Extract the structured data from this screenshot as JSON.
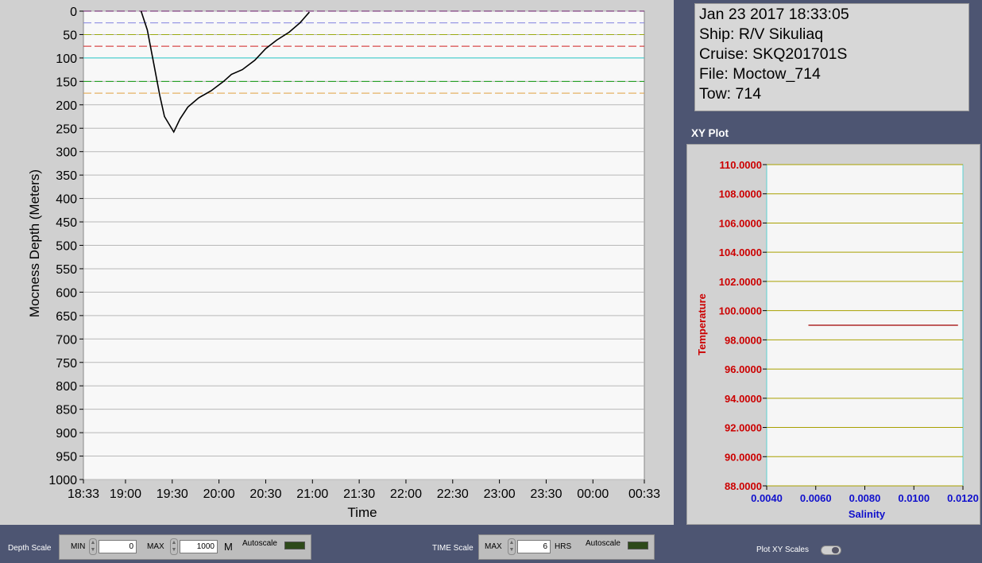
{
  "info": {
    "datetime": "Jan 23 2017 18:33:05",
    "ship": "Ship: R/V Sikuliaq",
    "cruise": "Cruise: SKQ201701S",
    "file": "File: Moctow_714",
    "tow": "Tow: 714"
  },
  "xy_plot": {
    "title": "XY Plot"
  },
  "bottom": {
    "depth_scale_label": "Depth Scale",
    "min_label": "MIN",
    "min_value": "0",
    "max_label": "MAX",
    "max_value": "1000",
    "depth_unit": "M",
    "autoscale_label": "Autoscale",
    "time_scale_label": "TIME Scale",
    "time_max_label": "MAX",
    "time_max_value": "6",
    "time_unit": "HRS",
    "time_autoscale_label": "Autoscale",
    "plot_xy_scales_label": "Plot XY Scales"
  },
  "chart_data": [
    {
      "type": "line",
      "xlabel": "Time",
      "ylabel": "Mocness Depth (Meters)",
      "x_ticks": [
        "18:33",
        "19:00",
        "19:30",
        "20:00",
        "20:30",
        "21:00",
        "21:30",
        "22:00",
        "22:30",
        "23:00",
        "23:30",
        "00:00",
        "00:33"
      ],
      "y_ticks": [
        "0",
        "50",
        "100",
        "150",
        "200",
        "250",
        "300",
        "350",
        "400",
        "450",
        "500",
        "550",
        "600",
        "650",
        "700",
        "750",
        "800",
        "850",
        "900",
        "950",
        "1000"
      ],
      "ylim": [
        0,
        1000
      ],
      "y_reversed": true,
      "grid": true,
      "reference_lines": [
        {
          "depth": 0,
          "color": "#6a1a6a"
        },
        {
          "depth": 25,
          "color": "#8080e0"
        },
        {
          "depth": 50,
          "color": "#9aaa10"
        },
        {
          "depth": 75,
          "color": "#d02020"
        },
        {
          "depth": 100,
          "color": "#30d0d0"
        },
        {
          "depth": 150,
          "color": "#109a10"
        },
        {
          "depth": 175,
          "color": "#e0a040"
        }
      ],
      "series": [
        {
          "color": "#000000",
          "points": [
            [
              "19:10",
              0
            ],
            [
              "19:14",
              40
            ],
            [
              "19:18",
              110
            ],
            [
              "19:22",
              180
            ],
            [
              "19:25",
              225
            ],
            [
              "19:31",
              258
            ],
            [
              "19:35",
              230
            ],
            [
              "19:40",
              205
            ],
            [
              "19:47",
              185
            ],
            [
              "19:55",
              170
            ],
            [
              "20:03",
              150
            ],
            [
              "20:08",
              135
            ],
            [
              "20:15",
              125
            ],
            [
              "20:23",
              105
            ],
            [
              "20:30",
              80
            ],
            [
              "20:37",
              62
            ],
            [
              "20:45",
              45
            ],
            [
              "20:52",
              25
            ],
            [
              "20:58",
              2
            ]
          ]
        }
      ]
    },
    {
      "type": "line",
      "title": "XY Plot",
      "xlabel": "Salinity",
      "ylabel": "Temperature",
      "x_ticks": [
        "0.0040",
        "0.0060",
        "0.0080",
        "0.0100",
        "0.0120"
      ],
      "y_ticks": [
        "110.0000",
        "108.0000",
        "106.0000",
        "104.0000",
        "102.0000",
        "100.0000",
        "98.0000",
        "96.0000",
        "94.0000",
        "92.0000",
        "90.0000",
        "88.0000"
      ],
      "xlim": [
        0.004,
        0.012
      ],
      "ylim": [
        88,
        110
      ],
      "grid": true,
      "series": [
        {
          "color": "#a00000",
          "points": [
            [
              0.0057,
              99
            ],
            [
              0.0118,
              99
            ]
          ]
        }
      ]
    }
  ]
}
